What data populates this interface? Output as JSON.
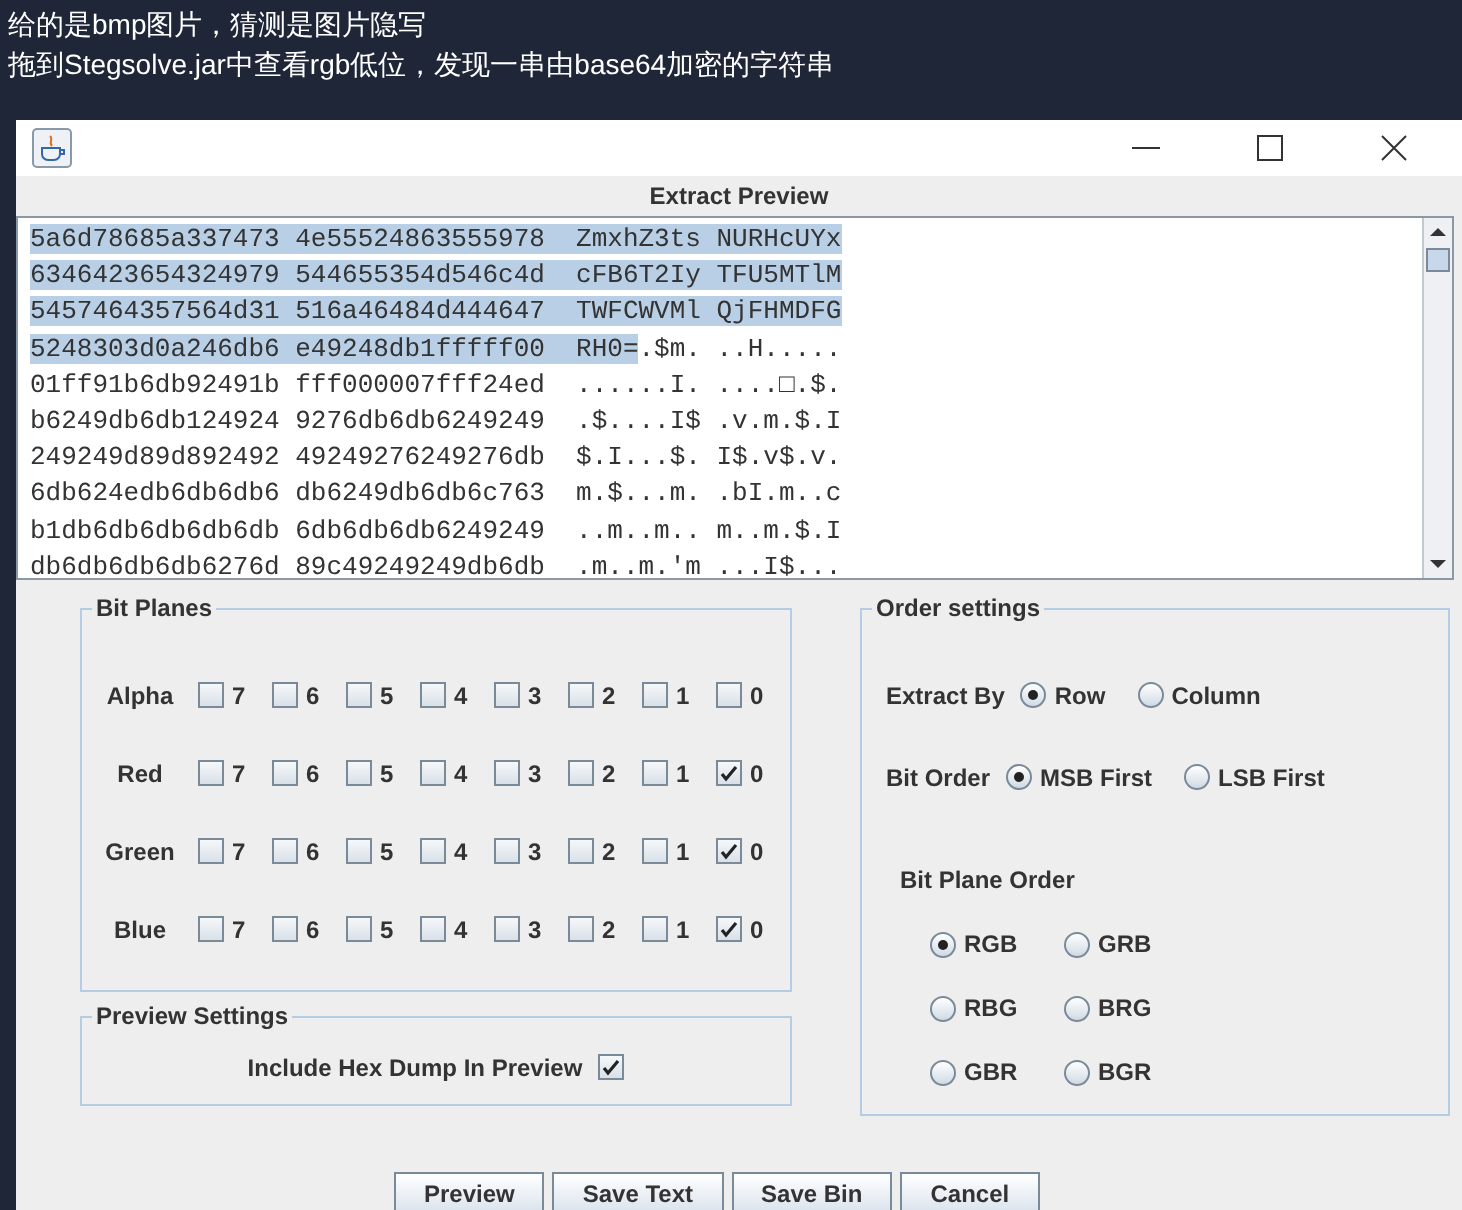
{
  "page_text": [
    "给的是bmp图片，猜测是图片隐写",
    "拖到Stegsolve.jar中查看rgb低位，发现一串由base64加密的字符串"
  ],
  "window": {
    "heading": "Extract Preview"
  },
  "preview": {
    "rows": [
      {
        "segments": [
          {
            "text": "5a6d78685a337473 4e55524863555978  ZmxhZ3ts NURHcUYx",
            "selected": true
          }
        ]
      },
      {
        "segments": [
          {
            "text": "6346423654324979 544655354d546c4d  cFB6T2Iy TFU5MTlM",
            "selected": true
          }
        ]
      },
      {
        "segments": [
          {
            "text": "5457464357564d31 516a46484d444647  TWFCWVMl QjFHMDFG",
            "selected": true
          }
        ]
      },
      {
        "segments": [
          {
            "text": "5248303d0a246db6 e49248db1fffff00  RH0=",
            "selected": true
          },
          {
            "text": ".$m. ..H.....",
            "selected": false
          }
        ]
      },
      {
        "segments": [
          {
            "text": "01ff91b6db92491b fff000007fff24ed  ......I. ....□.$.",
            "selected": false
          }
        ]
      },
      {
        "segments": [
          {
            "text": "b6249db6db124924 9276db6db6249249  .$....I$ .v.m.$.I",
            "selected": false
          }
        ]
      },
      {
        "segments": [
          {
            "text": "249249d89d892492 49249276249276db  $.I...$. I$.v$.v.",
            "selected": false
          }
        ]
      },
      {
        "segments": [
          {
            "text": "6db624edb6db6db6 db6249db6db6c763  m.$...m. .bI.m..c",
            "selected": false
          }
        ]
      },
      {
        "segments": [
          {
            "text": "b1db6db6db6db6db 6db6db6db6249249  ..m..m.. m..m.$.I",
            "selected": false
          }
        ]
      },
      {
        "segments": [
          {
            "text": "db6db6db6db6276d 89c49249249db6db  .m..m.'m ...I$...",
            "selected": false
          }
        ]
      }
    ]
  },
  "bit_planes": {
    "title": "Bit Planes",
    "channels": [
      {
        "name": "Alpha",
        "bits": [
          {
            "label": "7",
            "checked": false
          },
          {
            "label": "6",
            "checked": false
          },
          {
            "label": "5",
            "checked": false
          },
          {
            "label": "4",
            "checked": false
          },
          {
            "label": "3",
            "checked": false
          },
          {
            "label": "2",
            "checked": false
          },
          {
            "label": "1",
            "checked": false
          },
          {
            "label": "0",
            "checked": false
          }
        ]
      },
      {
        "name": "Red",
        "bits": [
          {
            "label": "7",
            "checked": false
          },
          {
            "label": "6",
            "checked": false
          },
          {
            "label": "5",
            "checked": false
          },
          {
            "label": "4",
            "checked": false
          },
          {
            "label": "3",
            "checked": false
          },
          {
            "label": "2",
            "checked": false
          },
          {
            "label": "1",
            "checked": false
          },
          {
            "label": "0",
            "checked": true
          }
        ]
      },
      {
        "name": "Green",
        "bits": [
          {
            "label": "7",
            "checked": false
          },
          {
            "label": "6",
            "checked": false
          },
          {
            "label": "5",
            "checked": false
          },
          {
            "label": "4",
            "checked": false
          },
          {
            "label": "3",
            "checked": false
          },
          {
            "label": "2",
            "checked": false
          },
          {
            "label": "1",
            "checked": false
          },
          {
            "label": "0",
            "checked": true
          }
        ]
      },
      {
        "name": "Blue",
        "bits": [
          {
            "label": "7",
            "checked": false
          },
          {
            "label": "6",
            "checked": false
          },
          {
            "label": "5",
            "checked": false
          },
          {
            "label": "4",
            "checked": false
          },
          {
            "label": "3",
            "checked": false
          },
          {
            "label": "2",
            "checked": false
          },
          {
            "label": "1",
            "checked": false
          },
          {
            "label": "0",
            "checked": true
          }
        ]
      }
    ]
  },
  "preview_settings": {
    "title": "Preview Settings",
    "option": {
      "label": "Include Hex Dump In Preview",
      "checked": true
    }
  },
  "order_settings": {
    "title": "Order settings",
    "extract_by": {
      "label": "Extract By",
      "options": [
        {
          "label": "Row",
          "selected": true
        },
        {
          "label": "Column",
          "selected": false
        }
      ]
    },
    "bit_order": {
      "label": "Bit Order",
      "options": [
        {
          "label": "MSB First",
          "selected": true
        },
        {
          "label": "LSB First",
          "selected": false
        }
      ]
    },
    "bit_plane_order": {
      "label": "Bit Plane Order",
      "options": [
        {
          "label": "RGB",
          "selected": true
        },
        {
          "label": "GRB",
          "selected": false
        },
        {
          "label": "RBG",
          "selected": false
        },
        {
          "label": "BRG",
          "selected": false
        },
        {
          "label": "GBR",
          "selected": false
        },
        {
          "label": "BGR",
          "selected": false
        }
      ]
    }
  },
  "buttons": [
    "Preview",
    "Save Text",
    "Save Bin",
    "Cancel"
  ]
}
